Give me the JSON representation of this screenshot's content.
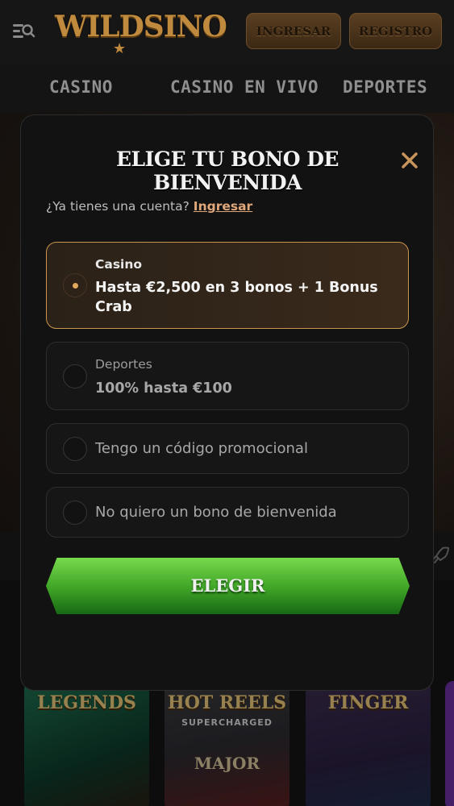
{
  "header": {
    "logo_text": "WILDSINO",
    "login_label": "INGRESAR",
    "register_label": "REGISTRO"
  },
  "nav": {
    "items": [
      {
        "label": "CASINO"
      },
      {
        "label": "CASINO EN VIVO"
      },
      {
        "label": "DEPORTES"
      }
    ]
  },
  "background_games": [
    {
      "title": "LEGENDS",
      "sub": "",
      "sub2": ""
    },
    {
      "title": "HOT REELS",
      "sub": "SUPERCHARGED",
      "sub2": "MAJOR"
    },
    {
      "title": "FINGER",
      "sub": "",
      "sub2": ""
    }
  ],
  "modal": {
    "title": "ELIGE TU BONO DE BIENVENIDA",
    "account_prompt": "¿Ya tienes una cuenta?",
    "login_link": "Ingresar",
    "options": [
      {
        "category": "Casino",
        "text": "Hasta €2,500 en 3 bonos + 1 Bonus Crab",
        "selected": true
      },
      {
        "category": "Deportes",
        "text": "100% hasta €100",
        "selected": false
      },
      {
        "text": "Tengo un código promocional",
        "selected": false
      },
      {
        "text": "No quiero un bono de bienvenida",
        "selected": false
      }
    ],
    "choose_label": "ELEGIR"
  },
  "colors": {
    "accent_gold": "#c9964f",
    "link": "#e0a77a",
    "cta_green": "#3ea326"
  },
  "icons": [
    "menu-search-icon",
    "star-icon",
    "close-icon",
    "rocket-icon"
  ]
}
